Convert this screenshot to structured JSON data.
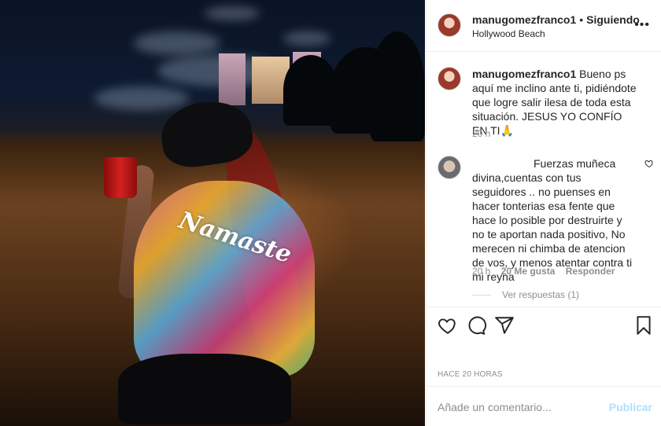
{
  "post": {
    "shirt_text": "Namaste",
    "author": "manugomezfranco1",
    "follow_status": "Siguiendo",
    "location": "Hollywood Beach",
    "more_icon": "more-icon"
  },
  "caption": {
    "username": "manugomezfranco1",
    "text": "Bueno ps aquí me inclino ante ti, pidiéndote que logre salir ilesa de toda esta situación. JESUS YO CONFÍO EN TI🙏",
    "time": "20 h"
  },
  "comment": {
    "text": "Fuerzas muñeca divina,cuentas con tus seguidores .. no puenses en hacer tonterias esa fente que hace lo posible por destruirte y no te aportan nada positivo, No merecen ni chimba de atencion de vos, y menos atentar contra ti mi reyna",
    "time": "20 h",
    "likes": "20 Me gusta",
    "reply_label": "Responder",
    "view_replies": "Ver respuestas (1)"
  },
  "actions": {
    "icons": [
      "heart-icon",
      "comment-icon",
      "share-icon",
      "bookmark-icon"
    ],
    "time_ago": "HACE 20 HORAS"
  },
  "add_comment": {
    "placeholder": "Añade un comentario...",
    "publish": "Publicar"
  },
  "colors": {
    "text": "#262626",
    "secondary": "#8e8e8e",
    "publish_disabled": "#b2dffc",
    "border": "#efefef"
  }
}
